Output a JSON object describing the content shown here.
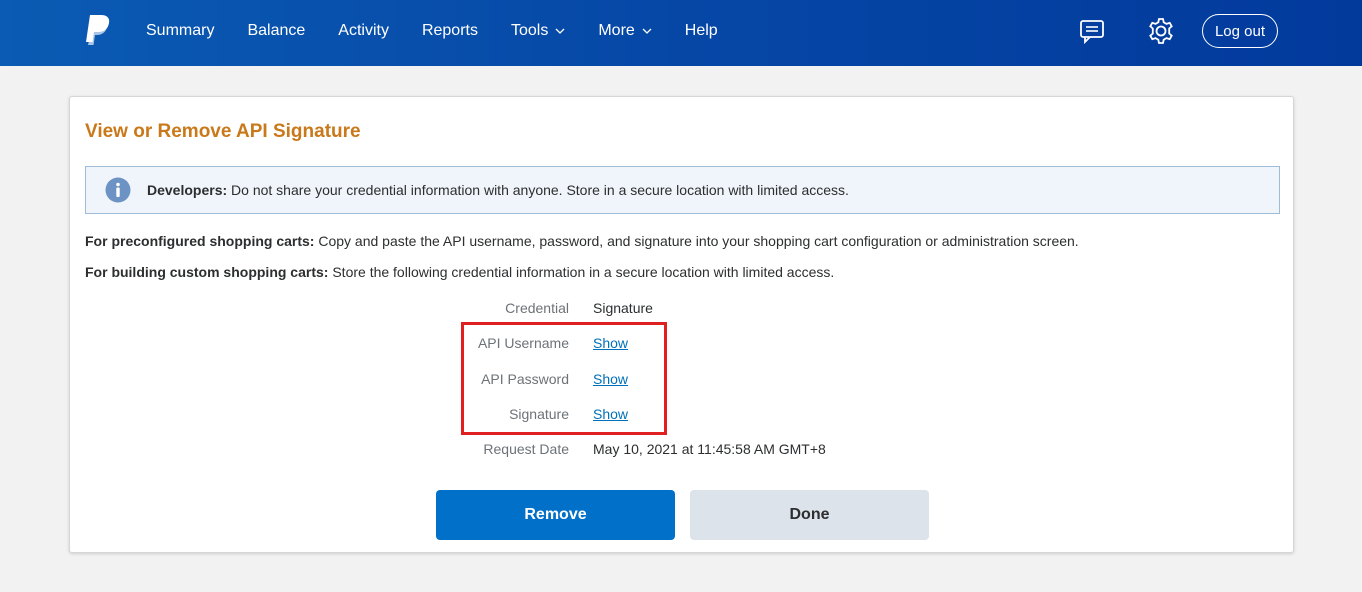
{
  "nav": {
    "items": [
      {
        "label": "Summary"
      },
      {
        "label": "Balance"
      },
      {
        "label": "Activity"
      },
      {
        "label": "Reports"
      },
      {
        "label": "Tools",
        "has_dropdown": true
      },
      {
        "label": "More",
        "has_dropdown": true
      },
      {
        "label": "Help"
      }
    ],
    "logout_label": "Log out",
    "icons": [
      "paypal-logo",
      "message-icon",
      "gear-icon"
    ]
  },
  "page": {
    "title": "View or Remove API Signature",
    "alert": {
      "bold": "Developers:",
      "text": " Do not share your credential information with anyone. Store in a secure location with limited access."
    },
    "para1": {
      "bold": "For preconfigured shopping carts:",
      "text": " Copy and paste the API username, password, and signature into your shopping cart configuration or administration screen."
    },
    "para2": {
      "bold": "For building custom shopping carts:",
      "text": " Store the following credential information in a secure location with limited access."
    },
    "credentials": {
      "credential_label": "Credential",
      "credential_value": "Signature",
      "username_label": "API Username",
      "username_action": "Show",
      "password_label": "API Password",
      "password_action": "Show",
      "signature_label": "Signature",
      "signature_action": "Show",
      "date_label": "Request Date",
      "date_value": "May 10, 2021 at 11:45:58 AM GMT+8"
    },
    "buttons": {
      "remove": "Remove",
      "done": "Done"
    }
  },
  "colors": {
    "header_blue": "#0647a6",
    "title_orange": "#c9791a",
    "link_blue": "#0070ba",
    "primary_button": "#0070c8",
    "highlight_red": "#e02020"
  }
}
